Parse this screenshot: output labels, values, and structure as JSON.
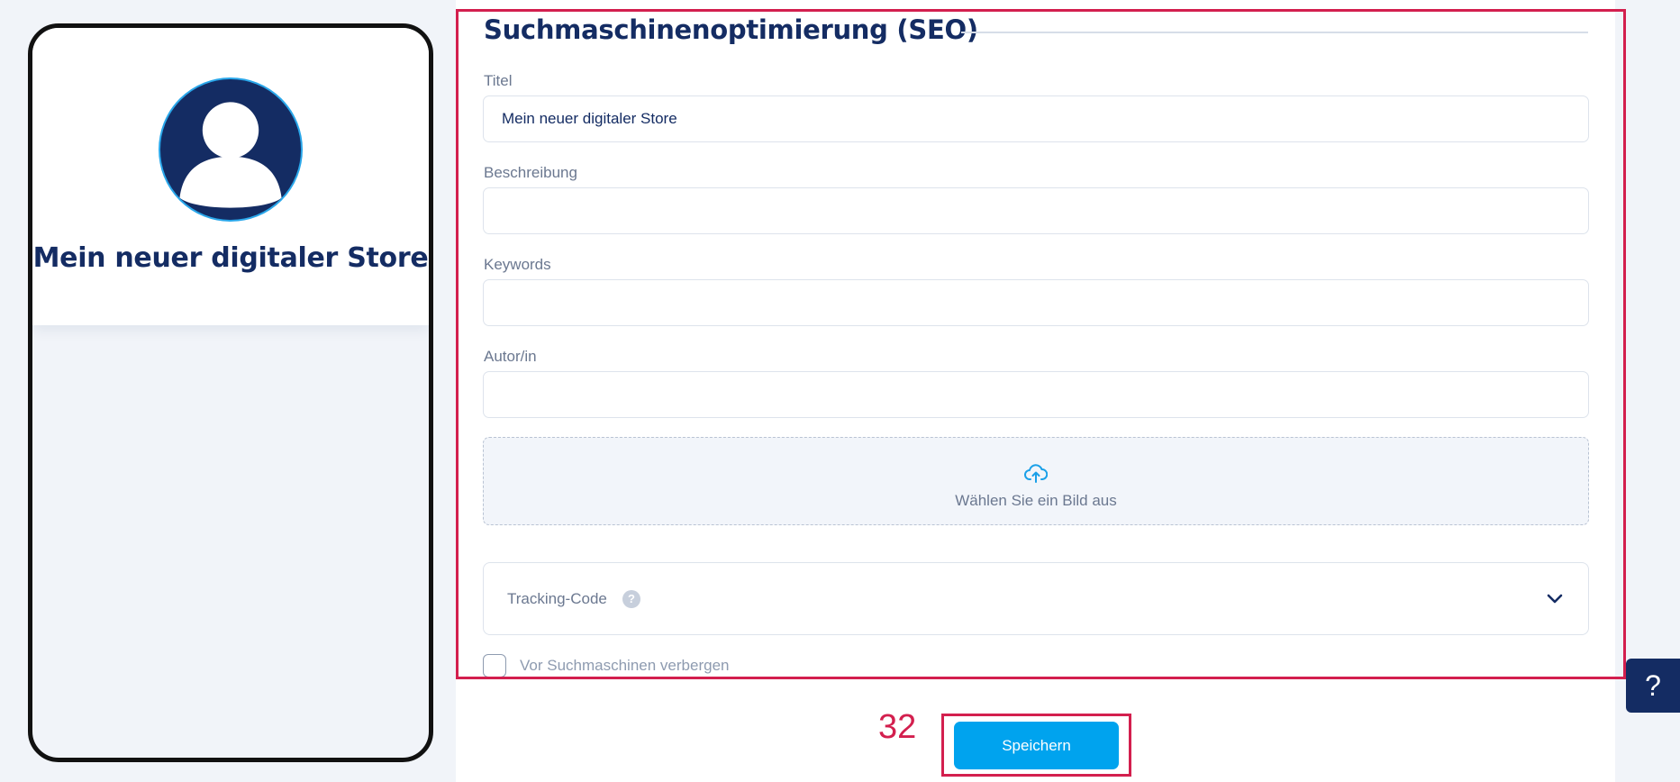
{
  "preview": {
    "store_name": "Mein neuer digitaler Store",
    "avatar_icon": "user-avatar-icon"
  },
  "seo": {
    "section_title": "Suchmaschinenoptimierung (SEO)",
    "fields": [
      {
        "label": "Titel",
        "value": "Mein neuer digitaler Store"
      },
      {
        "label": "Beschreibung",
        "value": ""
      },
      {
        "label": "Keywords",
        "value": ""
      },
      {
        "label": "Autor/in",
        "value": ""
      }
    ],
    "upload": {
      "icon": "cloud-upload-icon",
      "label": "Wählen Sie ein Bild aus"
    },
    "tracking": {
      "label": "Tracking-Code",
      "help": "?",
      "icon": "chevron-down-icon"
    },
    "hide_from_search": {
      "label": "Vor Suchmaschinen verbergen",
      "checked": false
    }
  },
  "annotation": {
    "number": "32"
  },
  "actions": {
    "save_label": "Speichern"
  },
  "help_widget": {
    "label": "?"
  },
  "colors": {
    "navy": "#142c63",
    "accent": "#00a3ee",
    "annotation": "#d31f4e"
  }
}
